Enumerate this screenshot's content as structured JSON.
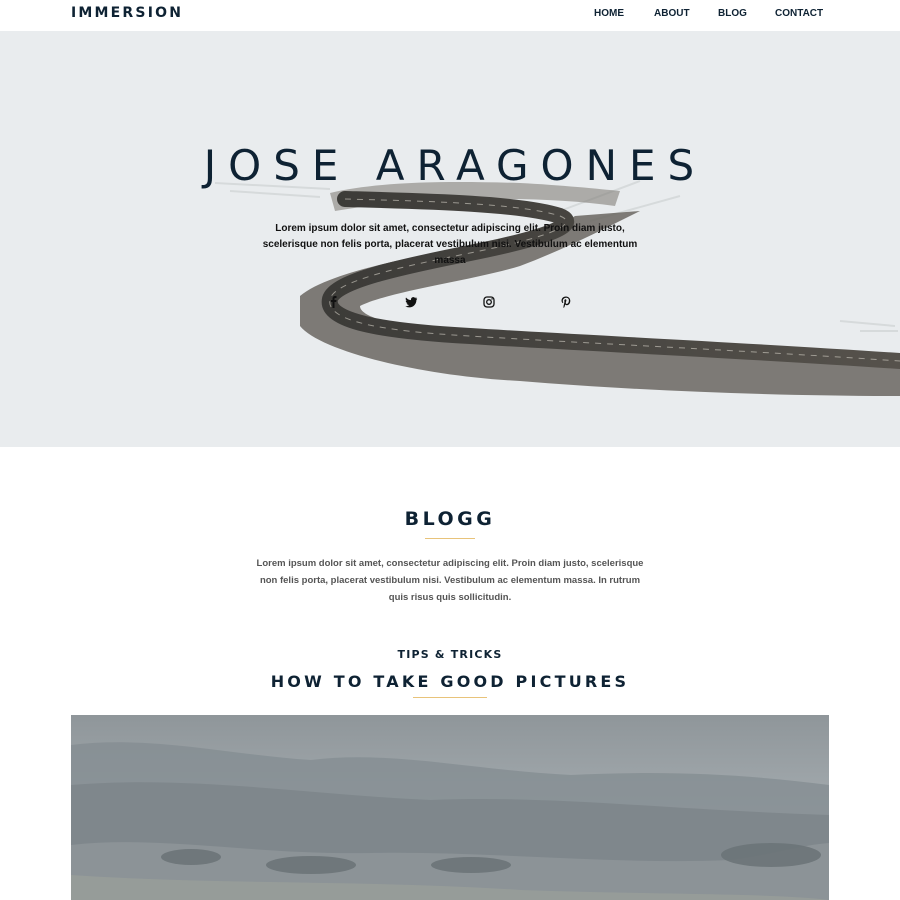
{
  "header": {
    "brand": "IMMERSION",
    "nav": [
      "HOME",
      "ABOUT",
      "BLOG",
      "CONTACT"
    ]
  },
  "hero": {
    "title": "JOSE ARAGONES",
    "text": "Lorem ipsum dolor sit amet, consectetur adipiscing elit. Proin diam justo, scelerisque non felis porta, placerat vestibulum nisi. Vestibulum ac elementum massa",
    "social": [
      "facebook-icon",
      "twitter-icon",
      "instagram-icon",
      "pinterest-icon"
    ]
  },
  "blog": {
    "title": "BLOGG",
    "text": "Lorem ipsum dolor sit amet, consectetur adipiscing elit. Proin diam justo, scelerisque non felis porta, placerat vestibulum nisi. Vestibulum ac elementum massa. In rutrum quis risus quis sollicitudin."
  },
  "post": {
    "kicker": "TIPS & TRICKS",
    "title": "HOW TO TAKE GOOD PICTURES"
  },
  "colors": {
    "navy": "#0e2233",
    "accent": "#e8c37a",
    "hero_bg": "#e9ecee"
  }
}
